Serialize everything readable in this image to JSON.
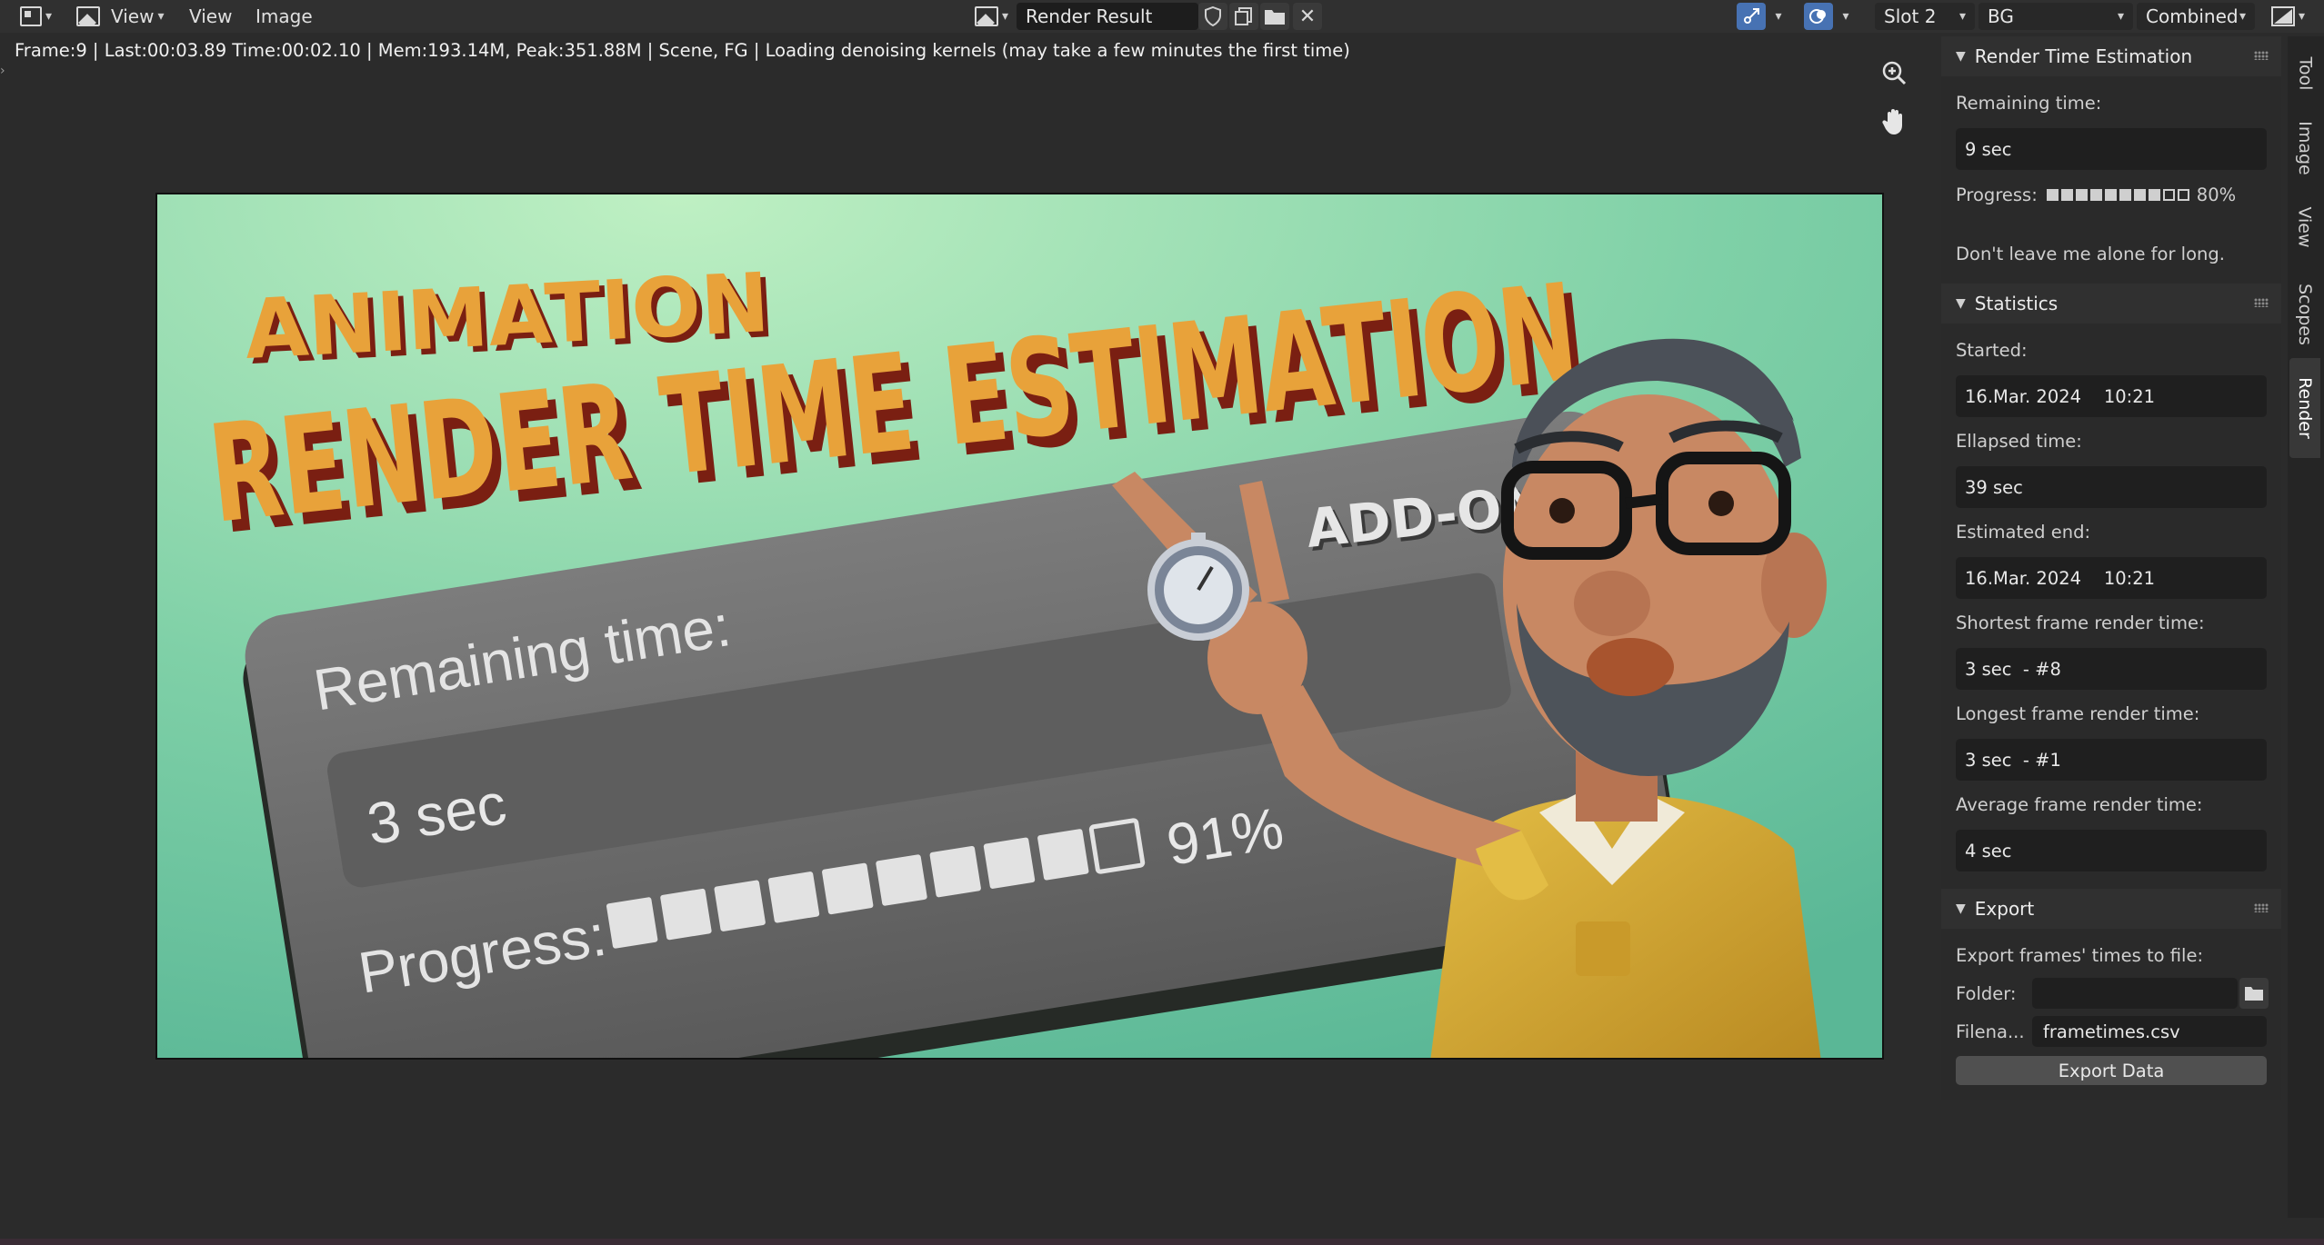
{
  "header": {
    "menus": [
      "View",
      "View",
      "Image"
    ],
    "image_name": "Render Result",
    "slot": "Slot 2",
    "view_layer": "BG",
    "pass": "Combined"
  },
  "status_bar": "Frame:9 | Last:00:03.89 Time:00:02.10 | Mem:193.14M, Peak:351.88M | Scene, FG | Loading denoising kernels (may take a few minutes the first time)",
  "render_image": {
    "title_small": "ANIMATION",
    "title_big": "RENDER TIME ESTIMATION",
    "addon_label": "ADD-ON",
    "card_remaining_label": "Remaining time:",
    "card_remaining_value": "3 sec",
    "card_progress_label": "Progress:",
    "card_progress_percent": "91%",
    "card_progress_filled": 9,
    "card_progress_total": 10
  },
  "panel": {
    "rte": {
      "title": "Render Time Estimation",
      "remaining_label": "Remaining time:",
      "remaining_value": "9 sec",
      "progress_label": "Progress:",
      "progress_percent": "80%",
      "progress_filled": 8,
      "progress_total": 10,
      "message": "Don't leave me alone for long."
    },
    "stats": {
      "title": "Statistics",
      "started_label": "Started:",
      "started_value": "16.Mar. 2024    10:21",
      "elapsed_label": "Ellapsed time:",
      "elapsed_value": "39 sec",
      "end_label": "Estimated end:",
      "end_value": "16.Mar. 2024    10:21",
      "shortest_label": "Shortest frame render time:",
      "shortest_value": "3 sec  - #8",
      "longest_label": "Longest frame render time:",
      "longest_value": "3 sec  - #1",
      "average_label": "Average frame render time:",
      "average_value": "4 sec"
    },
    "export": {
      "title": "Export",
      "description": "Export frames' times to file:",
      "folder_label": "Folder:",
      "folder_value": "",
      "filename_label": "Filena...",
      "filename_value": "frametimes.csv",
      "button": "Export Data"
    }
  },
  "tabs": [
    "Tool",
    "Image",
    "View",
    "Scopes",
    "Render"
  ],
  "active_tab": "Render",
  "colors": {
    "accent_blue": "#4772b3",
    "title_orange": "#e8a23a",
    "title_shadow": "#7a1f12",
    "background_green": "#7fd0a7"
  }
}
